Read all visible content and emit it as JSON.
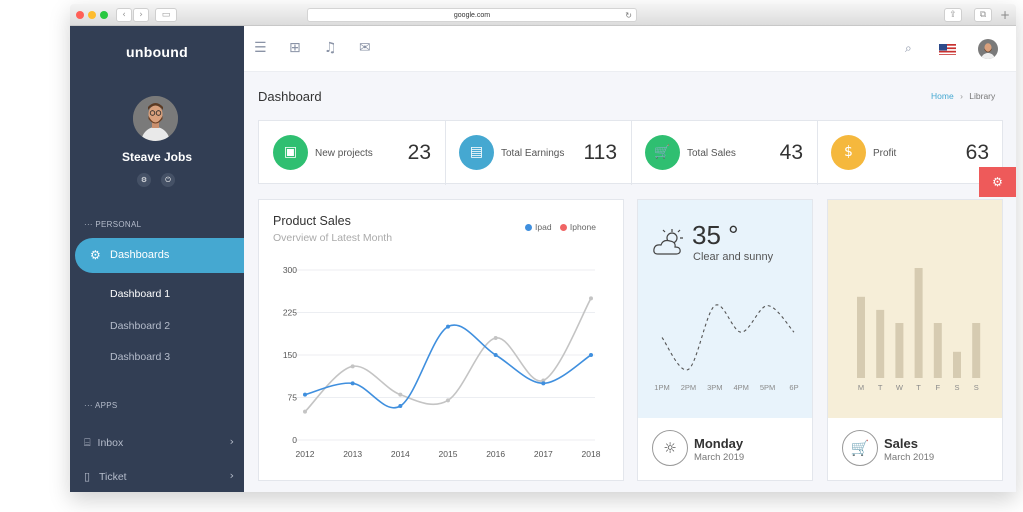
{
  "browser": {
    "url": "google.com",
    "back": "‹",
    "forward": "›"
  },
  "sidebar": {
    "brand": "unbound",
    "user": {
      "name": "Steave Jobs"
    },
    "section_personal": "··· PERSONAL",
    "active_item": "Dashboards",
    "sub_items": [
      "Dashboard 1",
      "Dashboard 2",
      "Dashboard 3"
    ],
    "section_apps": "··· APPS",
    "apps": [
      {
        "label": "Inbox",
        "chev": "›"
      },
      {
        "label": "Ticket",
        "chev": "›"
      }
    ]
  },
  "page": {
    "title": "Dashboard",
    "breadcrumb": {
      "home": "Home",
      "sep": "›",
      "current": "Library"
    }
  },
  "stats": [
    {
      "label": "New projects",
      "value": "23",
      "color": "#2fbf71",
      "icon": "▣"
    },
    {
      "label": "Total Earnings",
      "value": "113",
      "color": "#45a8d1",
      "icon": "▤"
    },
    {
      "label": "Total Sales",
      "value": "43",
      "color": "#2fbf71",
      "icon": "🛒"
    },
    {
      "label": "Profit",
      "value": "63",
      "color": "#f5b83d",
      "icon": "$"
    }
  ],
  "colors": {
    "sidebar": "#323e54",
    "accent": "#45a8d1",
    "ipad": "#3f8fde",
    "iphone": "#f06565",
    "weather_bg": "#e8f3fb",
    "sales_bg": "#f6eed8",
    "sales_bar": "#d6cbb1"
  },
  "chart_data": [
    {
      "type": "line",
      "title": "Product Sales",
      "subtitle": "Overview of Latest Month",
      "x": [
        "2012",
        "2013",
        "2014",
        "2015",
        "2016",
        "2017",
        "2018"
      ],
      "ylim": [
        0,
        300
      ],
      "yticks": [
        0,
        75,
        150,
        225,
        300
      ],
      "series": [
        {
          "name": "Ipad",
          "values": [
            80,
            100,
            60,
            200,
            150,
            100,
            150
          ]
        },
        {
          "name": "Iphone",
          "values": [
            50,
            130,
            80,
            70,
            180,
            105,
            250
          ]
        }
      ],
      "grid": true,
      "legend": "top-right"
    },
    {
      "type": "line",
      "x": [
        "1PM",
        "2PM",
        "3PM",
        "4PM",
        "5PM",
        "6P"
      ],
      "values": [
        40,
        10,
        70,
        45,
        70,
        45
      ]
    },
    {
      "type": "bar",
      "categories": [
        "M",
        "T",
        "W",
        "T",
        "F",
        "S",
        "S"
      ],
      "values": [
        62,
        52,
        42,
        84,
        42,
        20,
        42
      ]
    }
  ],
  "weather": {
    "temp": "35 °",
    "condition": "Clear and sunny",
    "day": "Monday",
    "date": "March 2019"
  },
  "sales_card": {
    "title": "Sales",
    "date": "March 2019"
  }
}
